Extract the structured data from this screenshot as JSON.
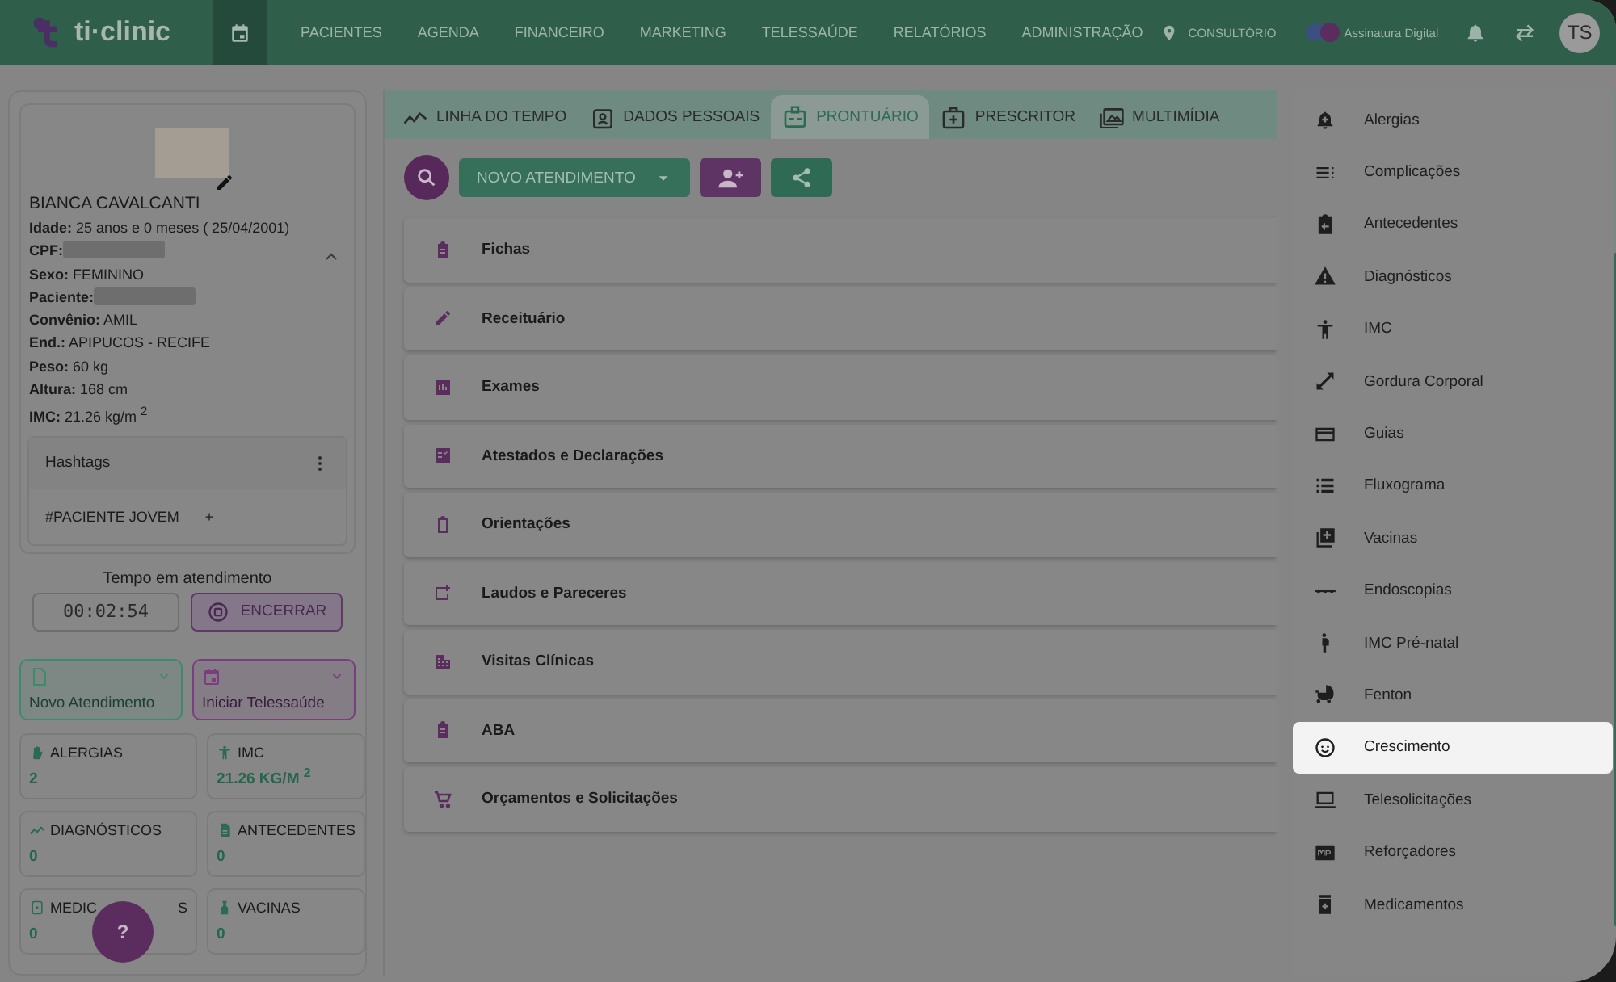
{
  "header": {
    "logo": "ti·clinic",
    "nav": [
      {
        "label": "PACIENTES",
        "selected": false
      },
      {
        "label": "AGENDA",
        "selected": false
      },
      {
        "label": "FINANCEIRO",
        "selected": false
      },
      {
        "label": "MARKETING",
        "selected": false
      },
      {
        "label": "TELESSAÚDE",
        "selected": false
      },
      {
        "label": "RELATÓRIOS",
        "selected": false
      },
      {
        "label": "ADMINISTRAÇÃO",
        "selected": false
      }
    ],
    "calendar_selected": true,
    "location": "CONSULTÓRIO",
    "signature": {
      "label": "Assinatura Digital",
      "on": true
    },
    "avatar": "TS"
  },
  "patient": {
    "name": "BIANCA CAVALCANTI",
    "fields": [
      {
        "kind": "text",
        "label": "Idade:",
        "value": "25 anos e 0 meses ( 25/04/2001)"
      },
      {
        "kind": "hidden",
        "label": "CPF:"
      },
      {
        "kind": "text",
        "label": "Sexo:",
        "value": "FEMININO"
      },
      {
        "kind": "hidden",
        "label": "Paciente:"
      },
      {
        "kind": "text",
        "label": "Convênio:",
        "value": "AMIL"
      },
      {
        "kind": "text",
        "label": "End.:",
        "value": "APIPUCOS -  RECIFE"
      },
      {
        "kind": "text",
        "label": "Peso:",
        "value": "60 kg"
      },
      {
        "kind": "text",
        "label": "Altura:",
        "value": "168 cm"
      },
      {
        "kind": "text",
        "label": "IMC:",
        "value": "21.26 kg/m $^{2}$"
      }
    ],
    "expanded": true,
    "hashtags": {
      "title": "Hashtags",
      "tags": [
        "#PACIENTE JOVEM"
      ],
      "add": "+"
    }
  },
  "timer": {
    "label": "Tempo em atendimento",
    "value": "00:02:54",
    "stop": "ENCERRAR"
  },
  "actions": [
    {
      "label": "Novo Atendimento",
      "color": "#3d8a6c"
    },
    {
      "label": "Iniciar Telessaúde",
      "color": "#7a3d80"
    }
  ],
  "summary": [
    {
      "label": [
        "ALERGIAS"
      ],
      "value": "2"
    },
    {
      "label": [
        "IMC"
      ],
      "value": "21.26 KG/M $^{2}$"
    },
    {
      "label": [
        "DIAGNÓSTICOS"
      ],
      "value": "0"
    },
    {
      "label": [
        "ANTECEDENTES"
      ],
      "value": "0"
    },
    {
      "label": [
        "MEDIC",
        "S"
      ],
      "value": "0"
    },
    {
      "label": [
        "VACINAS"
      ],
      "value": "0"
    }
  ],
  "help": "?",
  "tabs": [
    {
      "label": "LINHA DO TEMPO",
      "selected": false
    },
    {
      "label": "DADOS PESSOAIS",
      "selected": false
    },
    {
      "label": "PRONTUÁRIO",
      "selected": true
    },
    {
      "label": "PRESCRITOR",
      "selected": false
    },
    {
      "label": "MULTIMÍDIA",
      "selected": false
    }
  ],
  "toolbar": {
    "new_visit": "NOVO ATENDIMENTO"
  },
  "sections": [
    "Fichas",
    "Receituário",
    "Exames",
    "Atestados e Declarações",
    "Orientações",
    "Laudos e Pareceres",
    "Visitas Clínicas",
    "ABA",
    "Orçamentos e Solicitações"
  ],
  "menu": [
    {
      "label": "Alergias",
      "selected": false
    },
    {
      "label": "Complicações",
      "selected": false
    },
    {
      "label": "Antecedentes",
      "selected": false
    },
    {
      "label": "Diagnósticos",
      "selected": false
    },
    {
      "label": "IMC",
      "selected": false
    },
    {
      "label": "Gordura Corporal",
      "selected": false
    },
    {
      "label": "Guias",
      "selected": false
    },
    {
      "label": "Fluxograma",
      "selected": false
    },
    {
      "label": "Vacinas",
      "selected": false
    },
    {
      "label": "Endoscopias",
      "selected": false
    },
    {
      "label": "IMC Pré-natal",
      "selected": false
    },
    {
      "label": "Fenton",
      "selected": false
    },
    {
      "label": "Crescimento",
      "selected": true
    },
    {
      "label": "Telesolicitações",
      "selected": false
    },
    {
      "label": "Reforçadores",
      "selected": false
    },
    {
      "label": "Medicamentos",
      "selected": false
    }
  ]
}
